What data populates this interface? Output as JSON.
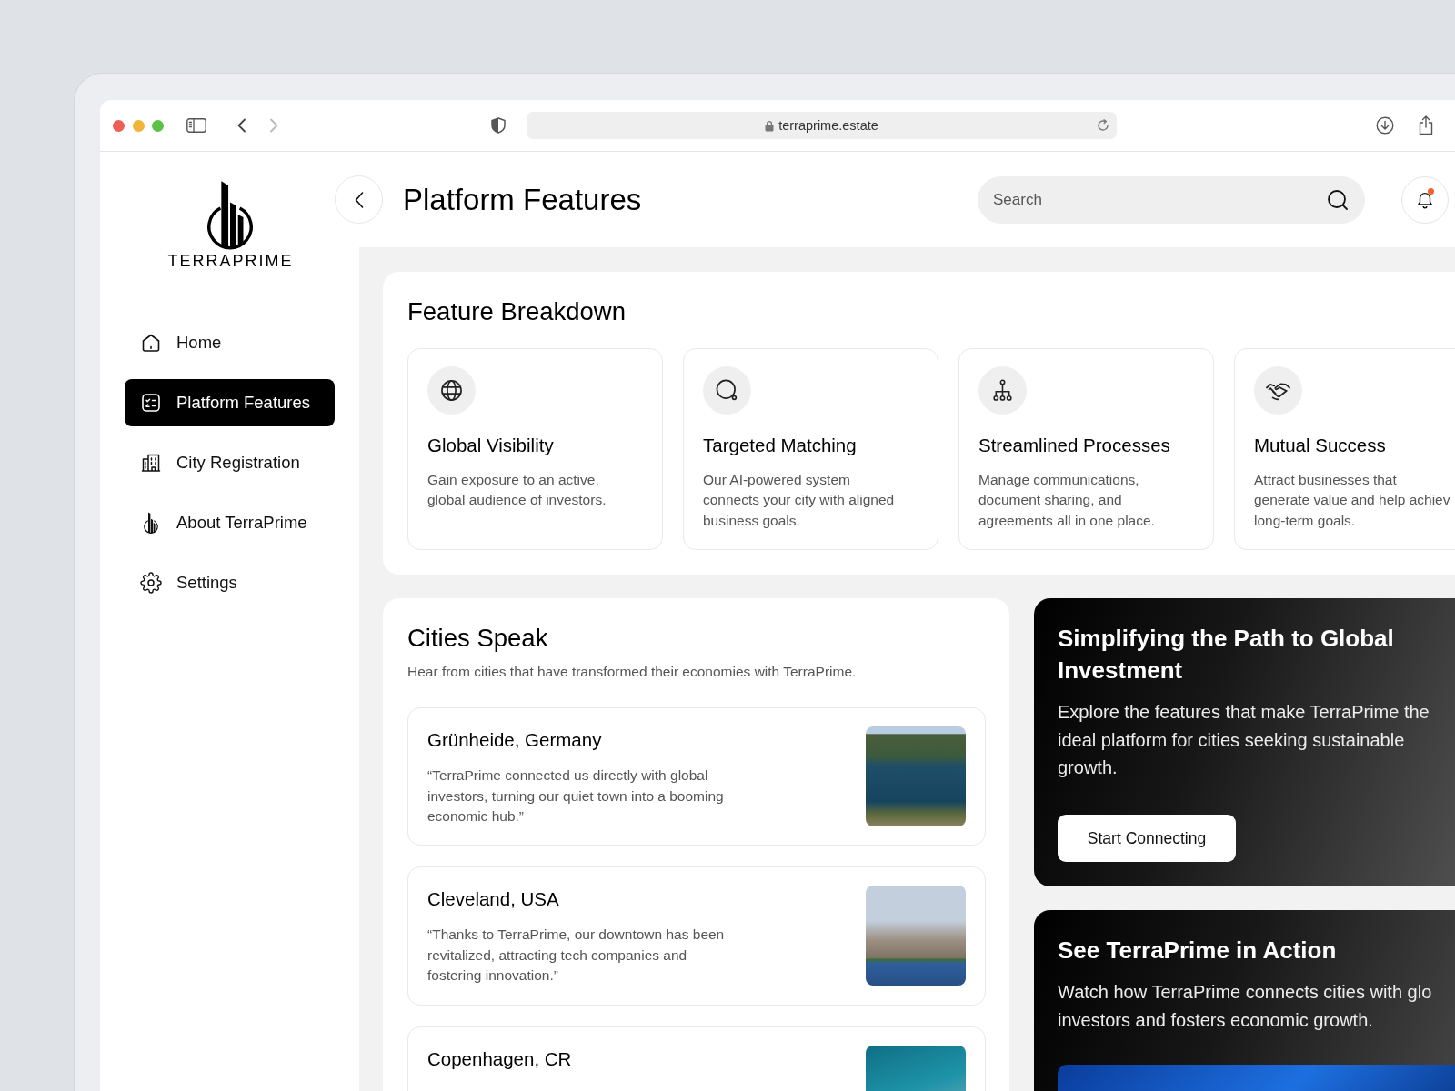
{
  "browser": {
    "url": "terraprime.estate",
    "nav_buttons": [
      {
        "kind": "back",
        "disabled": false
      },
      {
        "kind": "forward",
        "disabled": true
      }
    ]
  },
  "sidebar": {
    "logo_text": "TERRAPRIME",
    "items": [
      {
        "label": "Home",
        "selected": false
      },
      {
        "label": "Platform Features",
        "selected": true
      },
      {
        "label": "City Registration",
        "selected": false
      },
      {
        "label": "About TerraPrime",
        "selected": false
      },
      {
        "label": "Settings",
        "selected": false
      }
    ]
  },
  "header": {
    "title": "Platform Features",
    "search": {
      "placeholder": "Search"
    },
    "notifications": {
      "unread": true
    }
  },
  "feature_breakdown": {
    "title": "Feature Breakdown",
    "features": [
      {
        "title": "Global Visibility",
        "description": "Gain exposure to an active, global audience of investors."
      },
      {
        "title": "Targeted Matching",
        "description": "Our AI-powered system connects your city with aligned business goals."
      },
      {
        "title": "Streamlined Processes",
        "description": "Manage communications, document sharing, and agreements all in one place."
      },
      {
        "title": "Mutual Success",
        "description": "Attract businesses that generate value and help achiev long-term goals."
      }
    ]
  },
  "cities_speak": {
    "title": "Cities Speak",
    "subtitle": "Hear from cities that have transformed their economies with TerraPrime.",
    "testimonials": [
      {
        "city": "Grünheide, Germany",
        "quote": "“TerraPrime connected us directly with global investors, turning our quiet town into a booming economic hub.”"
      },
      {
        "city": "Cleveland, USA",
        "quote": "“Thanks to TerraPrime, our downtown has been revitalized, attracting tech companies and fostering innovation.”"
      },
      {
        "city": "Copenhagen, CR"
      }
    ]
  },
  "promo_cards": [
    {
      "kind": "cta",
      "title": "Simplifying the Path to Global Investment",
      "text": "Explore the features that make TerraPrime the ideal platform for cities seeking sustainable growth.",
      "button": "Start Connecting"
    },
    {
      "kind": "video",
      "title": "See TerraPrime in Action",
      "text": "Watch how TerraPrime connects cities with glo investors and fosters economic growth."
    }
  ]
}
